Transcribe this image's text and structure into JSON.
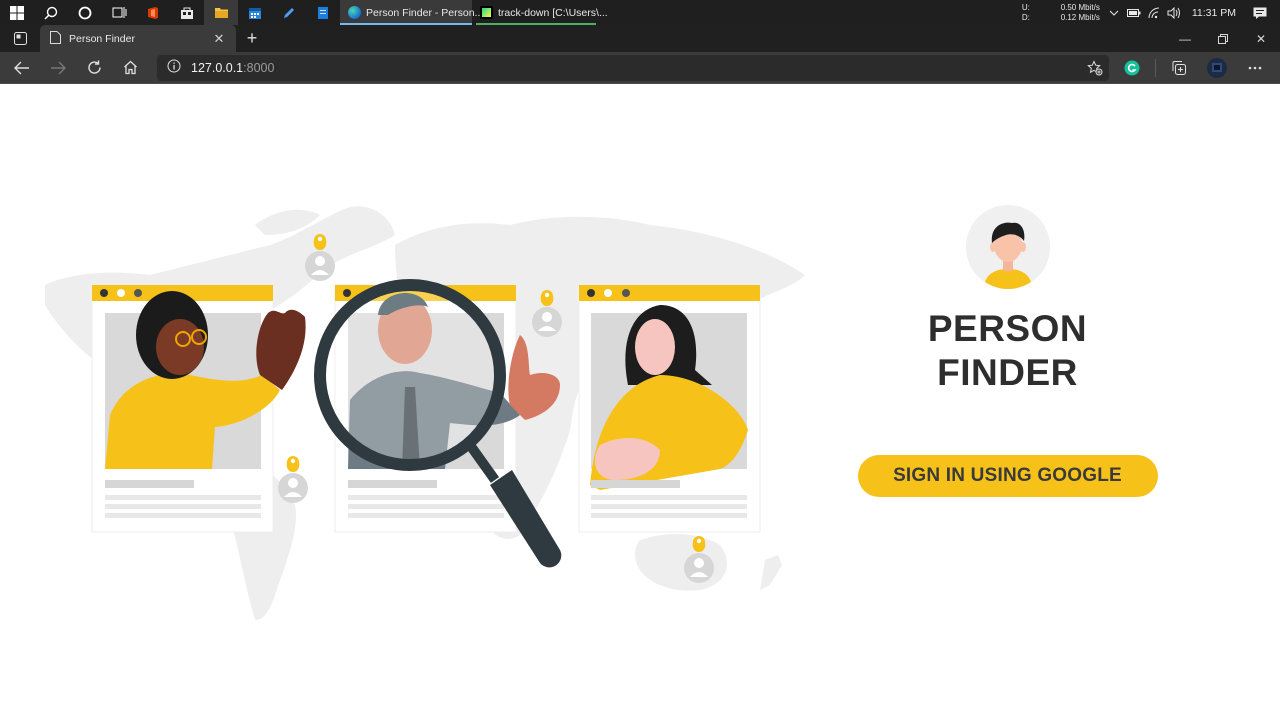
{
  "taskbar": {
    "apps": [
      {
        "label": "Person Finder - Person...",
        "icon": "edge-icon"
      },
      {
        "label": "track-down [C:\\Users\\...",
        "icon": "pycharm-icon"
      }
    ],
    "network": {
      "up_label": "U:",
      "up_value": "0.50 Mbit/s",
      "down_label": "D:",
      "down_value": "0.12 Mbit/s"
    },
    "clock": "11:31 PM"
  },
  "browser": {
    "tab_title": "Person Finder",
    "url_host": "127.0.0.1",
    "url_port": ":8000"
  },
  "page": {
    "title_line1": "PERSON",
    "title_line2": "FINDER",
    "signin_label": "SIGN IN USING GOOGLE"
  },
  "colors": {
    "accent_yellow": "#f6c21a",
    "title_text": "#2e2e2e",
    "map_gray": "#eeeeee"
  }
}
